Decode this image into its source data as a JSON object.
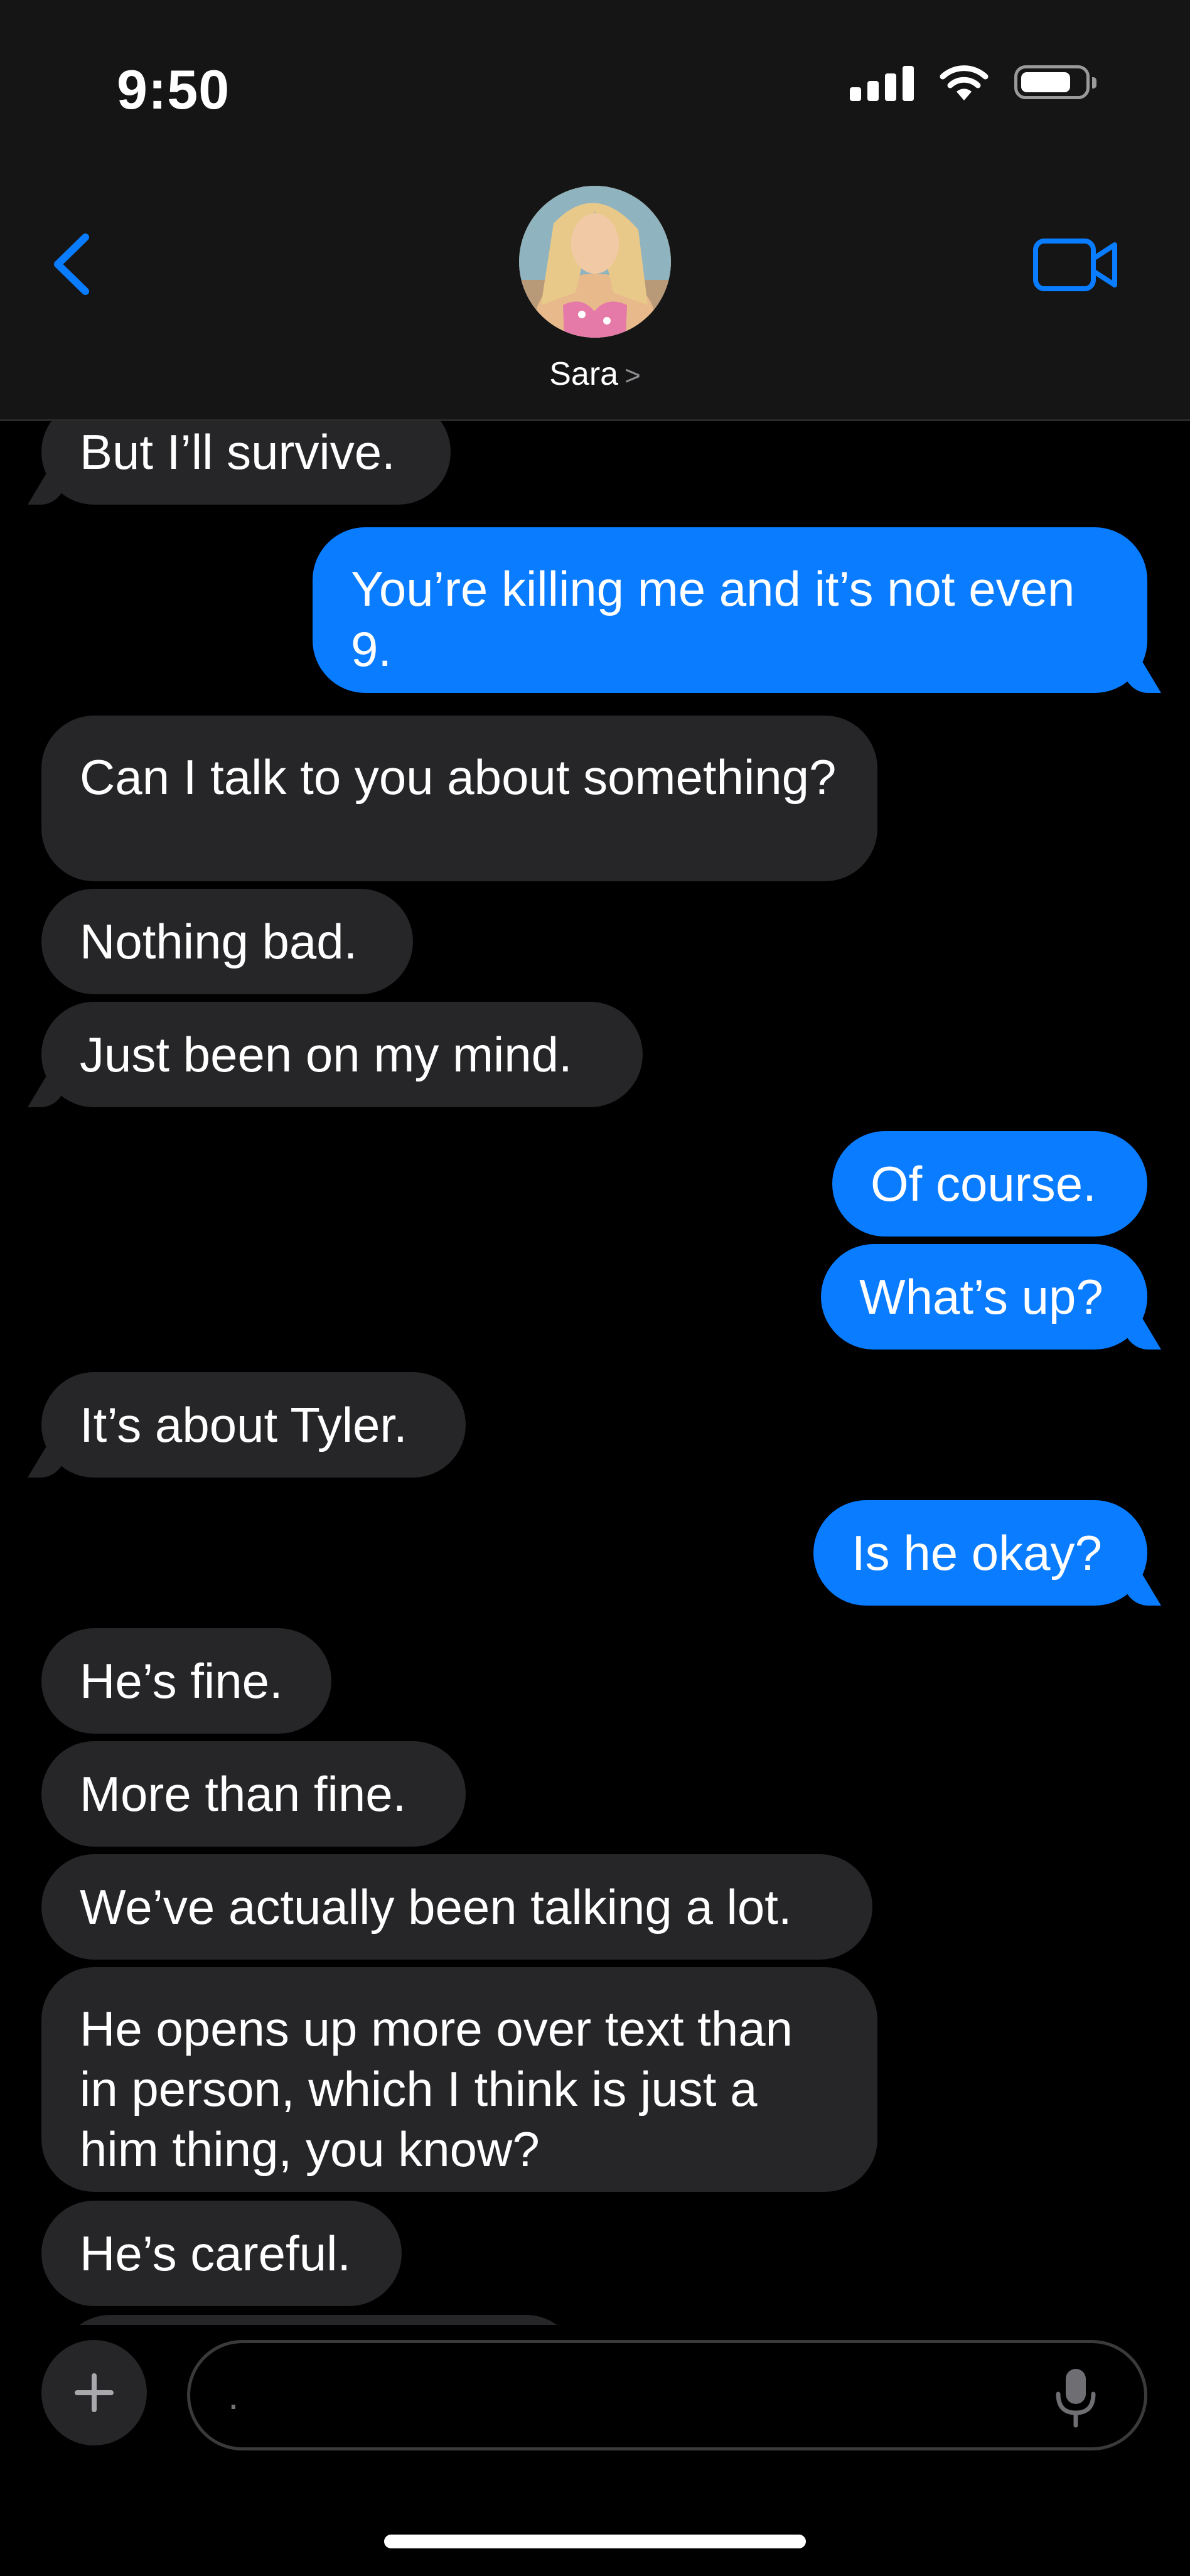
{
  "status_bar": {
    "time": "9:50"
  },
  "header": {
    "contact_name": "Sara",
    "name_chevron": ">",
    "back_icon": "chevron-left-icon",
    "video_icon": "video-camera-icon",
    "accent_color": "#0a7cff"
  },
  "messages": [
    {
      "from": "them",
      "text": "But I’ll survive."
    },
    {
      "from": "me",
      "text": "You’re killing me and it’s not even 9."
    },
    {
      "from": "them",
      "text": "Can I talk to you about something?"
    },
    {
      "from": "them",
      "text": "Nothing bad."
    },
    {
      "from": "them",
      "text": "Just been on my mind."
    },
    {
      "from": "me",
      "text": "Of course."
    },
    {
      "from": "me",
      "text": "What’s up?"
    },
    {
      "from": "them",
      "text": "It’s about Tyler."
    },
    {
      "from": "me",
      "text": "Is he okay?"
    },
    {
      "from": "them",
      "text": "He’s fine."
    },
    {
      "from": "them",
      "text": "More than fine."
    },
    {
      "from": "them",
      "text": "We’ve actually been talking a lot."
    },
    {
      "from": "them",
      "text": "He opens up more over text than in person, which I think is just a him thing, you know?"
    },
    {
      "from": "them",
      "text": "He’s careful."
    }
  ],
  "composer": {
    "placeholder": ".",
    "plus_icon": "plus-icon",
    "mic_icon": "microphone-icon"
  },
  "colors": {
    "incoming_bubble": "#262628",
    "outgoing_bubble": "#0a7cff",
    "header_bg": "#151515"
  }
}
